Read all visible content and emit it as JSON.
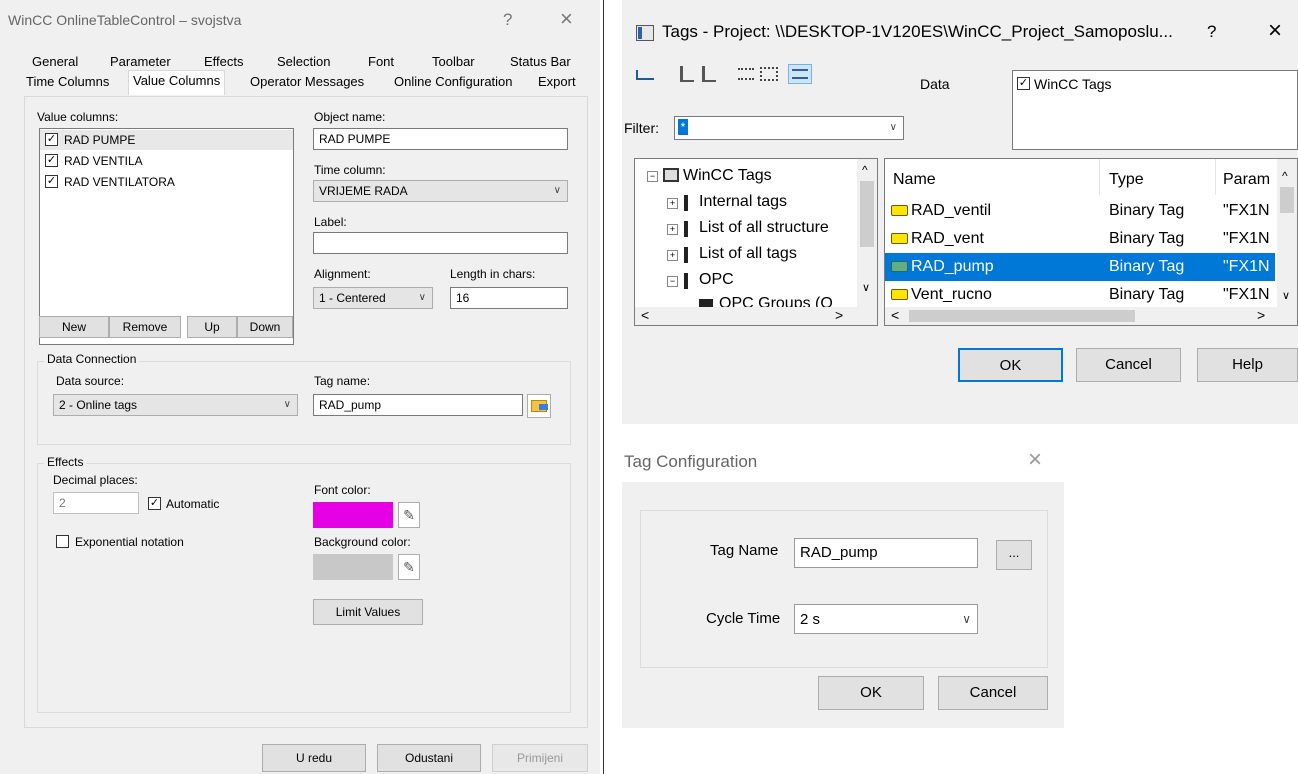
{
  "props": {
    "title": "WinCC OnlineTableControl – svojstva",
    "help": "?",
    "close": "×",
    "tabs_row1": [
      "General",
      "Parameter",
      "Effects",
      "Selection",
      "Font",
      "Toolbar",
      "Status Bar"
    ],
    "tabs_row2": [
      "Time Columns",
      "Value Columns",
      "Operator Messages",
      "Online Configuration",
      "Export"
    ],
    "value_columns_label": "Value columns:",
    "columns": [
      {
        "label": "RAD PUMPE",
        "checked": true
      },
      {
        "label": "RAD VENTILA",
        "checked": true
      },
      {
        "label": "RAD VENTILATORA",
        "checked": true
      }
    ],
    "check": "✓",
    "new_btn": "New",
    "remove_btn": "Remove",
    "up_btn": "Up",
    "down_btn": "Down",
    "object_name_label": "Object name:",
    "object_name": "RAD PUMPE",
    "time_column_label": "Time column:",
    "time_column": "VRIJEME RADA",
    "label_label": "Label:",
    "label_value": "",
    "alignment_label": "Alignment:",
    "alignment": "1 - Centered",
    "length_label": "Length in chars:",
    "length": "16",
    "data_connection": "Data Connection",
    "data_source_label": "Data source:",
    "data_source": "2 - Online tags",
    "tag_name_label": "Tag name:",
    "tag_name": "RAD_pump",
    "effects": "Effects",
    "decimal_label": "Decimal places:",
    "decimal": "2",
    "automatic": "Automatic",
    "exponential": "Exponential notation",
    "font_color_label": "Font color:",
    "font_color": "#e600e6",
    "bg_color_label": "Background color:",
    "bg_color": "#c8c8c8",
    "limit_values": "Limit Values",
    "ok": "U redu",
    "cancel": "Odustani",
    "apply": "Primijeni"
  },
  "tags": {
    "title": "Tags - Project: \\\\DESKTOP-1V120ES\\WinCC_Project_Samoposlu...",
    "help": "?",
    "close": "×",
    "data_label": "Data",
    "data_item": "WinCC Tags",
    "filter_label": "Filter:",
    "filter_value": "*",
    "tree": [
      "WinCC Tags",
      "Internal tags",
      "List of all structure",
      "List of all tags",
      "OPC",
      "OPC Groups (O"
    ],
    "columns": [
      "Name",
      "Type",
      "Param"
    ],
    "rows": [
      {
        "name": "RAD_ventil",
        "type": "Binary Tag",
        "param": "\"FX1N"
      },
      {
        "name": "RAD_vent",
        "type": "Binary Tag",
        "param": "\"FX1N"
      },
      {
        "name": "RAD_pump",
        "type": "Binary Tag",
        "param": "\"FX1N"
      },
      {
        "name": "Vent_rucno",
        "type": "Binary Tag",
        "param": "\"FX1N"
      }
    ],
    "ok": "OK",
    "cancel": "Cancel",
    "help_btn": "Help"
  },
  "tagcfg": {
    "title": "Tag Configuration",
    "close": "×",
    "tag_name_label": "Tag Name",
    "tag_name": "RAD_pump",
    "browse": "...",
    "cycle_label": "Cycle Time",
    "cycle": "2 s",
    "ok": "OK",
    "cancel": "Cancel"
  }
}
